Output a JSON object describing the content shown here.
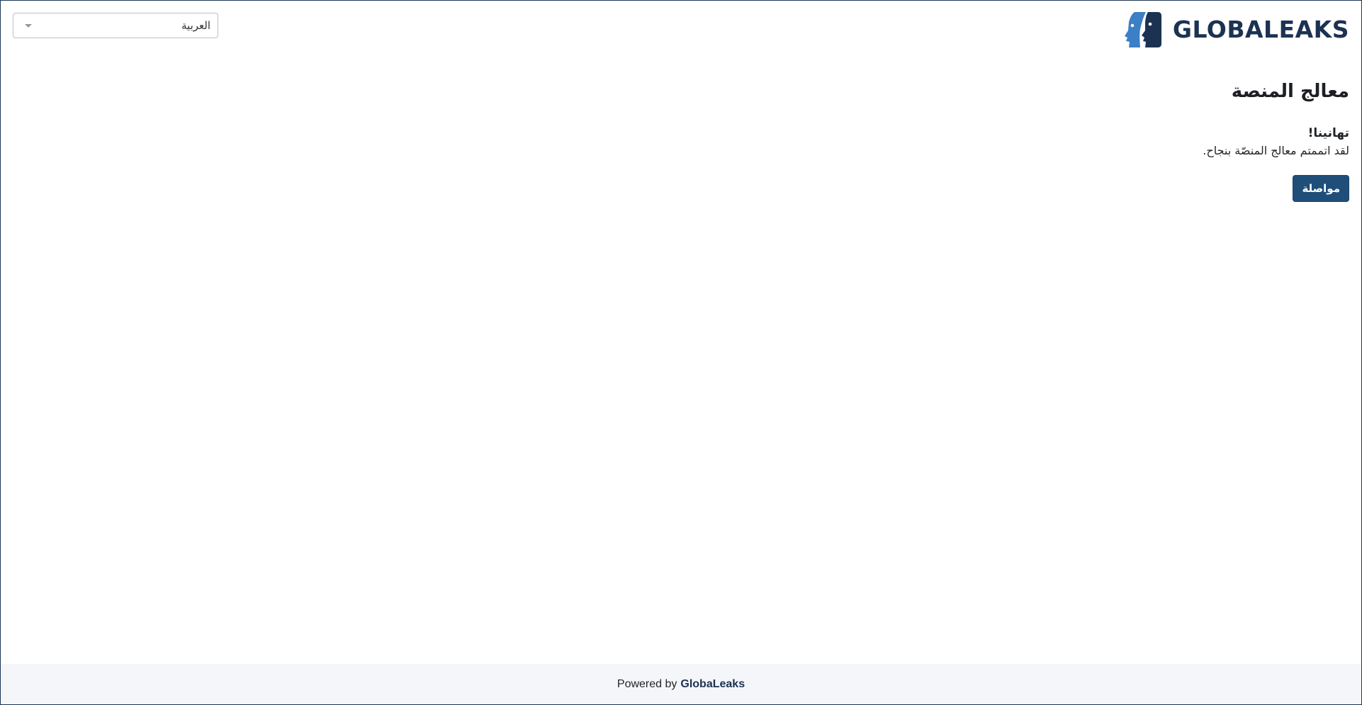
{
  "header": {
    "language_selector": {
      "selected_value": "العربية"
    },
    "logo": {
      "wordmark": "GLOBALEAKS",
      "colors": {
        "light_face": "#3c7fc4",
        "dark_face": "#1c3253"
      }
    }
  },
  "main": {
    "title": "معالج المنصة",
    "congrats_heading": "تهانينا!",
    "congrats_message": "لقد اتممتم معالج المنصّة بنجاح.",
    "continue_button": "مواصلة"
  },
  "footer": {
    "powered_by": "Powered by",
    "brand": "GlobaLeaks"
  },
  "colors": {
    "primary_button": "#1f4e79",
    "footer_background": "#f4f6f9",
    "frame_border": "#1d3557"
  }
}
